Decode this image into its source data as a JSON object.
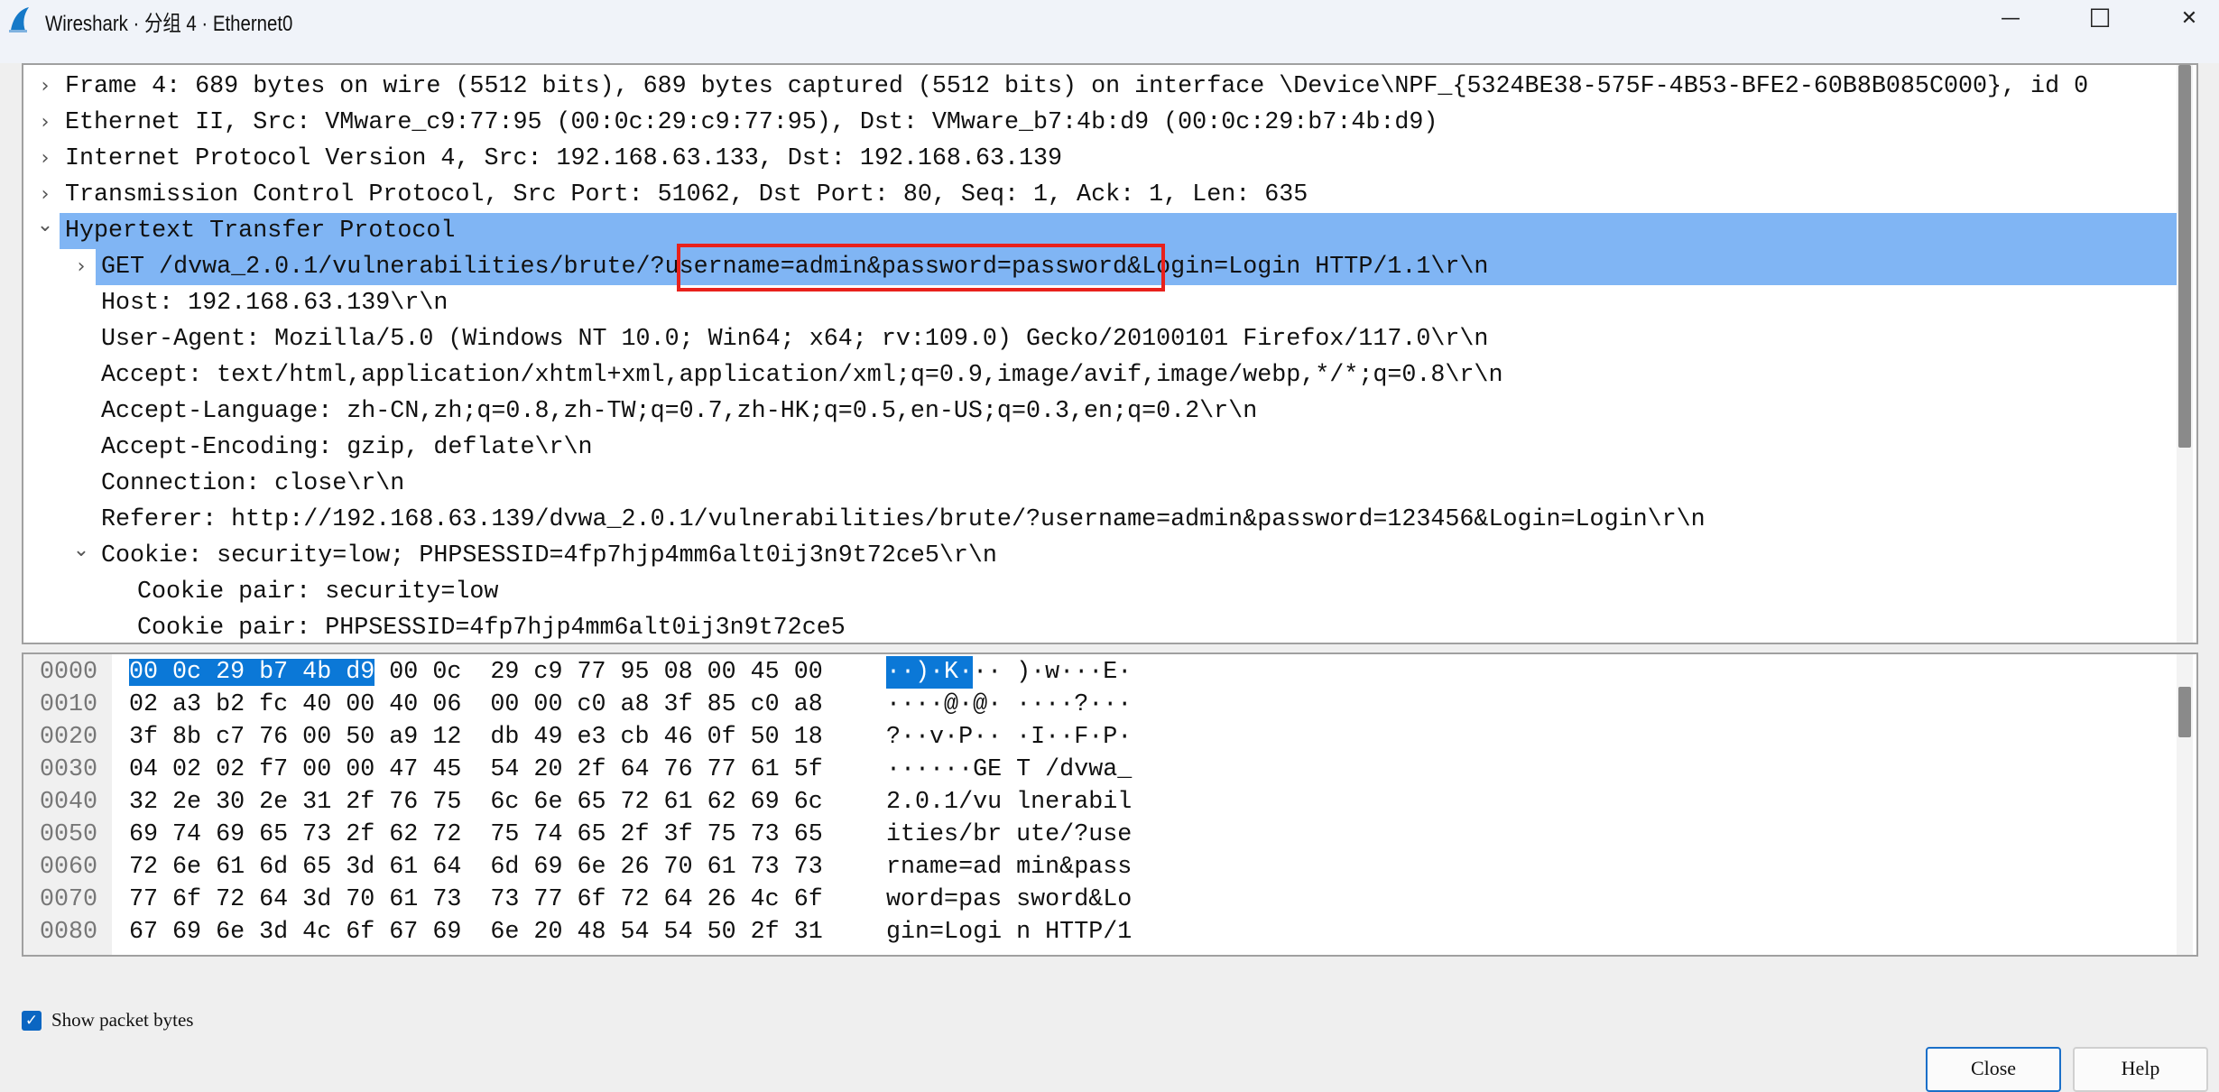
{
  "window": {
    "title": "Wireshark · 分组 4 · Ethernet0",
    "minimize": "—",
    "maximize": "☐",
    "close": "✕"
  },
  "tree": [
    {
      "level": 0,
      "expanded": false,
      "text": "Frame 4: 689 bytes on wire (5512 bits), 689 bytes captured (5512 bits) on interface \\Device\\NPF_{5324BE38-575F-4B53-BFE2-60B8B085C000}, id 0"
    },
    {
      "level": 0,
      "expanded": false,
      "text": "Ethernet II, Src: VMware_c9:77:95 (00:0c:29:c9:77:95), Dst: VMware_b7:4b:d9 (00:0c:29:b7:4b:d9)"
    },
    {
      "level": 0,
      "expanded": false,
      "text": "Internet Protocol Version 4, Src: 192.168.63.133, Dst: 192.168.63.139"
    },
    {
      "level": 0,
      "expanded": false,
      "text": "Transmission Control Protocol, Src Port: 51062, Dst Port: 80, Seq: 1, Ack: 1, Len: 635"
    },
    {
      "level": 0,
      "expanded": true,
      "selected": true,
      "text": "Hypertext Transfer Protocol"
    },
    {
      "level": 1,
      "expanded": false,
      "selected": true,
      "text": "GET /dvwa_2.0.1/vulnerabilities/brute/?username=admin&password=password&Login=Login HTTP/1.1\\r\\n"
    },
    {
      "level": 1,
      "text": "Host: 192.168.63.139\\r\\n"
    },
    {
      "level": 1,
      "text": "User-Agent: Mozilla/5.0 (Windows NT 10.0; Win64; x64; rv:109.0) Gecko/20100101 Firefox/117.0\\r\\n"
    },
    {
      "level": 1,
      "text": "Accept: text/html,application/xhtml+xml,application/xml;q=0.9,image/avif,image/webp,*/*;q=0.8\\r\\n"
    },
    {
      "level": 1,
      "text": "Accept-Language: zh-CN,zh;q=0.8,zh-TW;q=0.7,zh-HK;q=0.5,en-US;q=0.3,en;q=0.2\\r\\n"
    },
    {
      "level": 1,
      "text": "Accept-Encoding: gzip, deflate\\r\\n"
    },
    {
      "level": 1,
      "text": "Connection: close\\r\\n"
    },
    {
      "level": 1,
      "text": "Referer: http://192.168.63.139/dvwa_2.0.1/vulnerabilities/brute/?username=admin&password=123456&Login=Login\\r\\n"
    },
    {
      "level": 1,
      "expanded": true,
      "text": "Cookie: security=low; PHPSESSID=4fp7hjp4mm6alt0ij3n9t72ce5\\r\\n"
    },
    {
      "level": 2,
      "text": "Cookie pair: security=low"
    },
    {
      "level": 2,
      "text": "Cookie pair: PHPSESSID=4fp7hjp4mm6alt0ij3n9t72ce5"
    }
  ],
  "highlight_color": "#80b5f4",
  "annotation_color": "#e8211c",
  "hex": {
    "highlighted_bytes": 6,
    "rows": [
      {
        "offset": "0000",
        "bytes": [
          "00",
          "0c",
          "29",
          "b7",
          "4b",
          "d9",
          "00",
          "0c",
          "29",
          "c9",
          "77",
          "95",
          "08",
          "00",
          "45",
          "00"
        ],
        "ascii": "··)·K··· )·w···E·"
      },
      {
        "offset": "0010",
        "bytes": [
          "02",
          "a3",
          "b2",
          "fc",
          "40",
          "00",
          "40",
          "06",
          "00",
          "00",
          "c0",
          "a8",
          "3f",
          "85",
          "c0",
          "a8"
        ],
        "ascii": "····@·@· ····?···"
      },
      {
        "offset": "0020",
        "bytes": [
          "3f",
          "8b",
          "c7",
          "76",
          "00",
          "50",
          "a9",
          "12",
          "db",
          "49",
          "e3",
          "cb",
          "46",
          "0f",
          "50",
          "18"
        ],
        "ascii": "?··v·P·· ·I··F·P·"
      },
      {
        "offset": "0030",
        "bytes": [
          "04",
          "02",
          "02",
          "f7",
          "00",
          "00",
          "47",
          "45",
          "54",
          "20",
          "2f",
          "64",
          "76",
          "77",
          "61",
          "5f"
        ],
        "ascii": "······GE T /dvwa_"
      },
      {
        "offset": "0040",
        "bytes": [
          "32",
          "2e",
          "30",
          "2e",
          "31",
          "2f",
          "76",
          "75",
          "6c",
          "6e",
          "65",
          "72",
          "61",
          "62",
          "69",
          "6c"
        ],
        "ascii": "2.0.1/vu lnerabil"
      },
      {
        "offset": "0050",
        "bytes": [
          "69",
          "74",
          "69",
          "65",
          "73",
          "2f",
          "62",
          "72",
          "75",
          "74",
          "65",
          "2f",
          "3f",
          "75",
          "73",
          "65"
        ],
        "ascii": "ities/br ute/?use"
      },
      {
        "offset": "0060",
        "bytes": [
          "72",
          "6e",
          "61",
          "6d",
          "65",
          "3d",
          "61",
          "64",
          "6d",
          "69",
          "6e",
          "26",
          "70",
          "61",
          "73",
          "73"
        ],
        "ascii": "rname=ad min&pass"
      },
      {
        "offset": "0070",
        "bytes": [
          "77",
          "6f",
          "72",
          "64",
          "3d",
          "70",
          "61",
          "73",
          "73",
          "77",
          "6f",
          "72",
          "64",
          "26",
          "4c",
          "6f"
        ],
        "ascii": "word=pas sword&Lo"
      },
      {
        "offset": "0080",
        "bytes": [
          "67",
          "69",
          "6e",
          "3d",
          "4c",
          "6f",
          "67",
          "69",
          "6e",
          "20",
          "48",
          "54",
          "54",
          "50",
          "2f",
          "31"
        ],
        "ascii": "gin=Logi n HTTP/1"
      }
    ]
  },
  "footer": {
    "show_bytes_label": "Show packet bytes",
    "show_bytes_checked": true,
    "close_label": "Close",
    "help_label": "Help"
  }
}
